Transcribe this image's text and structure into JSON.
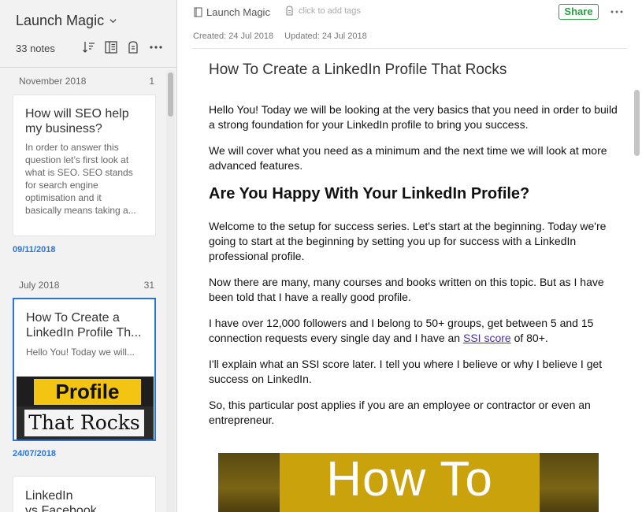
{
  "notebook": {
    "title": "Launch Magic",
    "note_count": "33 notes"
  },
  "list": {
    "groups": [
      {
        "month": "November 2018",
        "count": "1",
        "notes": [
          {
            "title_lines": [
              "How will SEO help",
              "my business?"
            ],
            "snippet_lines": [
              "In order to answer this",
              "question let’s first look at",
              "what is SEO. SEO stands",
              "for search engine",
              "optimisation and it",
              "basically means taking a..."
            ],
            "date": "09/11/2018"
          }
        ]
      },
      {
        "month": "July 2018",
        "count": "31",
        "notes": [
          {
            "title_lines": [
              "How To Create a",
              "LinkedIn Profile Th..."
            ],
            "snippet_lines": [
              "Hello You! Today we will..."
            ],
            "thumbnail_lines": [
              "Profile",
              "That Rocks"
            ],
            "date": "24/07/2018",
            "selected": true
          },
          {
            "title_lines": [
              "LinkedIn",
              "vs Facebook"
            ]
          }
        ]
      }
    ]
  },
  "editor": {
    "notebook_crumb": "Launch Magic",
    "tags_placeholder": "click to add tags",
    "share_label": "Share",
    "created": "Created: 24 Jul 2018",
    "updated": "Updated: 24 Jul 2018",
    "title": "How To Create a LinkedIn Profile That Rocks",
    "body": {
      "p1": "Hello You! Today we will be looking at the very basics that you need in order to build a strong foundation for your LinkedIn profile to bring you success.",
      "p2": "We will cover what you need as a minimum and the next time we will look at more advanced features.",
      "heading": "Are You Happy With Your LinkedIn Profile?",
      "p3": "Welcome to the setup for success series. Let's start at the beginning. Today we're going to start at the beginning by setting you up for success with a LinkedIn professional profile.",
      "p4": "Now there are many, many courses and books written on this topic. But as I have been told that I have a really good profile.",
      "p5_before": "I have over 12,000 followers and I belong to 50+ groups, get between 5 and 15 connection requests every single day and I have an ",
      "p5_link": "SSI score",
      "p5_after": " of 80+.",
      "p6": "I'll explain what an SSI score later. I tell you where I believe or why I believe I get success on LinkedIn.",
      "p7": "So, this particular post applies if you are an employee or contractor or even an entrepreneur.",
      "hero_text": "How To"
    }
  },
  "colors": {
    "accent": "#2b74d6",
    "share_green": "#2a9d45",
    "link": "#4b2bb0"
  }
}
